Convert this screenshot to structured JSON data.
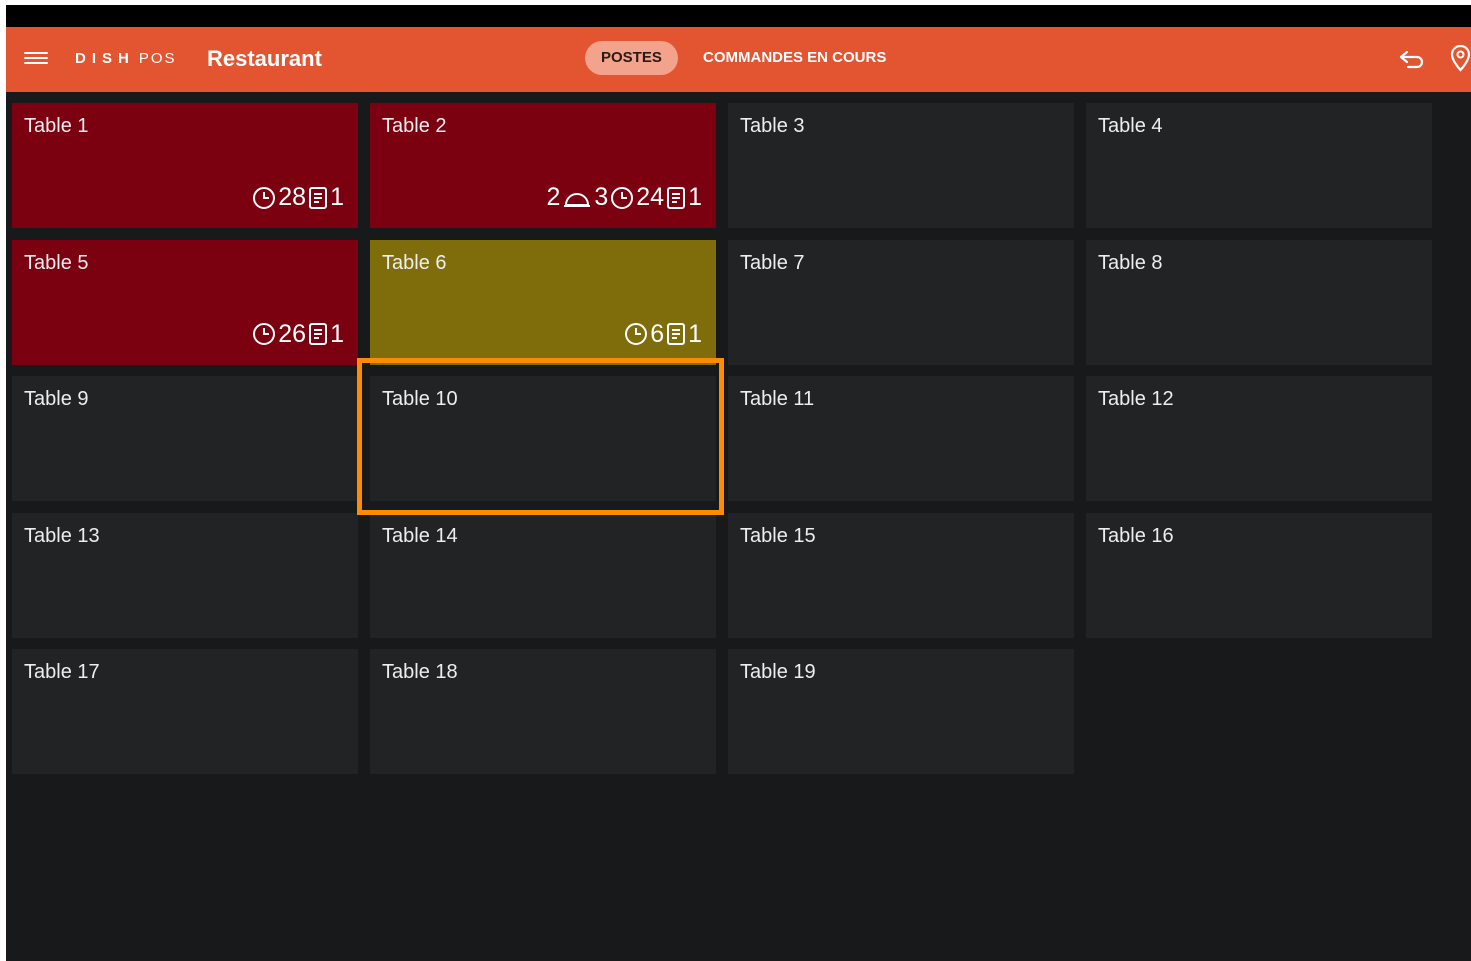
{
  "appbar": {
    "brand_dish": "DISH",
    "brand_pos": "POS",
    "title": "Restaurant",
    "tab_active": "POSTES",
    "tab_other": "COMMANDES EN COURS",
    "icons": [
      "menu-icon",
      "back-arrow-icon",
      "location-pin-icon"
    ],
    "accent_color": "#e35431"
  },
  "tables": [
    {
      "label": "Table 1",
      "status": "red",
      "minutes": "28",
      "tickets": "1"
    },
    {
      "label": "Table 2",
      "status": "red",
      "guests": "2",
      "courses": "3",
      "minutes": "24",
      "tickets": "1"
    },
    {
      "label": "Table 3",
      "status": "free"
    },
    {
      "label": "Table 4",
      "status": "free"
    },
    {
      "label": "Table 5",
      "status": "red",
      "minutes": "26",
      "tickets": "1"
    },
    {
      "label": "Table 6",
      "status": "olive",
      "minutes": "6",
      "tickets": "1"
    },
    {
      "label": "Table 7",
      "status": "free"
    },
    {
      "label": "Table 8",
      "status": "free"
    },
    {
      "label": "Table 9",
      "status": "free"
    },
    {
      "label": "Table 10",
      "status": "free",
      "highlighted": true
    },
    {
      "label": "Table 11",
      "status": "free"
    },
    {
      "label": "Table 12",
      "status": "free"
    },
    {
      "label": "Table 13",
      "status": "free"
    },
    {
      "label": "Table 14",
      "status": "free"
    },
    {
      "label": "Table 15",
      "status": "free"
    },
    {
      "label": "Table 16",
      "status": "free"
    },
    {
      "label": "Table 17",
      "status": "free"
    },
    {
      "label": "Table 18",
      "status": "free"
    },
    {
      "label": "Table 19",
      "status": "free"
    }
  ],
  "colors": {
    "occupied_red": "#7b0010",
    "occupied_olive": "#7f6d0c",
    "free": "#222325",
    "highlight": "#ff8b00"
  }
}
